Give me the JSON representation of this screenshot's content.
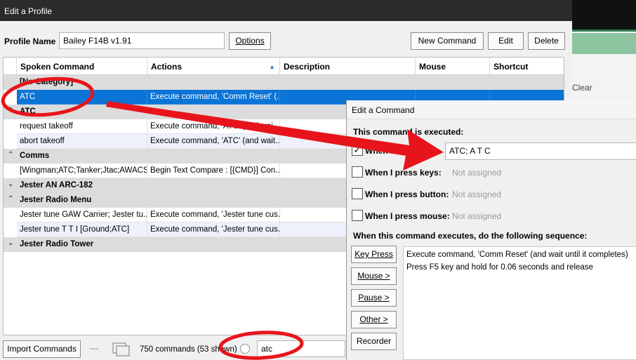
{
  "profile_window": {
    "title": "Edit a Profile",
    "profile_name_label": "Profile Name",
    "profile_name_value": "Bailey F14B v1.91",
    "options_button": "Options",
    "new_command_button": "New Command",
    "edit_button": "Edit",
    "delete_button": "Delete",
    "columns": [
      "Spoken Command",
      "Actions",
      "Description",
      "Mouse",
      "Shortcut"
    ],
    "rows": [
      {
        "type": "category",
        "name": "[No Category]"
      },
      {
        "type": "command",
        "spoken": "ATC",
        "action": "Execute command, 'Comm Reset' (...",
        "selected": true
      },
      {
        "type": "category",
        "name": "ATC",
        "arrow": "^"
      },
      {
        "type": "command",
        "spoken": "request takeoff",
        "action": "Execute command, 'ATC' (and wai..."
      },
      {
        "type": "command",
        "spoken": "abort takeoff",
        "action": "Execute command, 'ATC' (and wait...",
        "alt": true
      },
      {
        "type": "category",
        "name": "Comms",
        "arrow": "^"
      },
      {
        "type": "command",
        "spoken": "[Wingman;ATC;Tanker;Jtac;AWACS;...",
        "action": "Begin Text Compare : [{CMD}] Con..."
      },
      {
        "type": "category",
        "name": "Jester AN ARC-182",
        "arrow": "v"
      },
      {
        "type": "category",
        "name": "Jester Radio Menu",
        "arrow": "^"
      },
      {
        "type": "command",
        "spoken": "Jester tune GAW Carrier; Jester tu...",
        "action": "Execute command, 'Jester tune cus..."
      },
      {
        "type": "command",
        "spoken": "Jester tune T T I [Ground;ATC]",
        "action": "Execute command, 'Jester tune cus...",
        "alt": true
      },
      {
        "type": "category",
        "name": "Jester Radio Tower",
        "arrow": "v"
      }
    ],
    "import_button": "Import Commands",
    "command_count": "750 commands (53 shown)",
    "filter_value": "atc"
  },
  "command_window": {
    "title": "Edit a Command",
    "executed_label": "This command is executed:",
    "when_say_label": "When I say",
    "when_say_checked": true,
    "when_say_value": "ATC; A T C",
    "keys_label": "When I press keys:",
    "keys_value": "Not assigned",
    "button_label": "When I press button:",
    "button_value": "Not assigned",
    "mouse_label": "When I press mouse:",
    "mouse_value": "Not assigned",
    "sequence_label": "When this command executes, do the following sequence:",
    "buttons": [
      "Key Press",
      "Mouse >",
      "Pause >",
      "Other >",
      "Recorder"
    ],
    "sequence": [
      "Execute command, 'Comm Reset' (and wait until it completes)",
      "Press F5 key and hold for 0.06 seconds and release"
    ]
  },
  "background_app": {
    "clear_label": "Clear"
  },
  "colors": {
    "selection": "#0b74d7",
    "annotation_red": "#e8141c",
    "title_bar": "#2b2b2b"
  }
}
